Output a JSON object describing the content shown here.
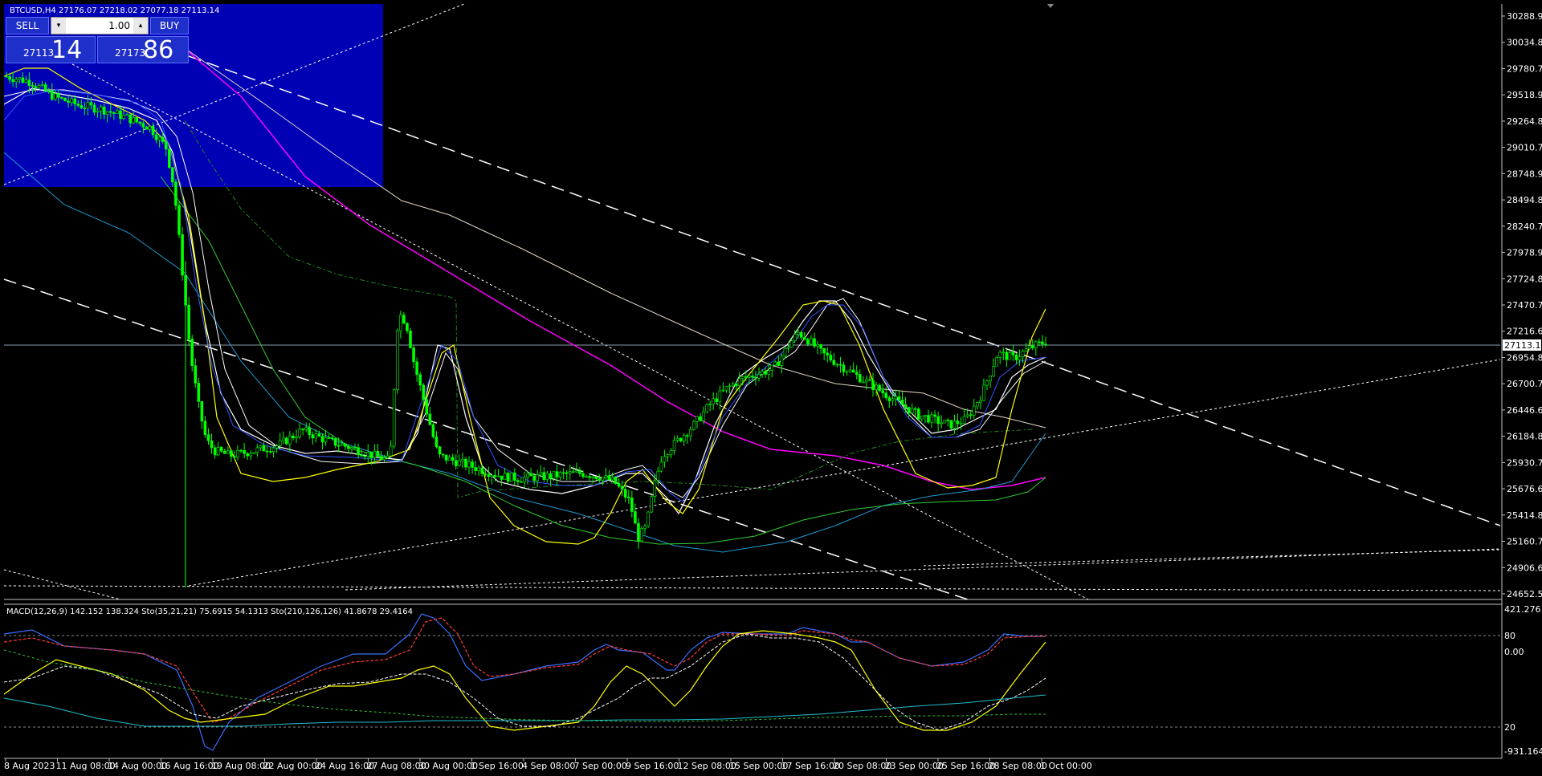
{
  "symbol_header": {
    "symbol": "BTCUSD,H4",
    "ohlc": "27176.07 27218.02 27077.18 27113.14"
  },
  "trade_panel": {
    "sell_label": "SELL",
    "buy_label": "BUY",
    "lot": "1.00",
    "sell_small": "27113",
    "sell_big": "14",
    "buy_small": "27173",
    "buy_big": "86"
  },
  "current_price": "27113.14",
  "colors": {
    "candles": "#00ff00",
    "panel": "#0000b4",
    "ma_white": "#ffffff",
    "ma_yellow": "#ffff00",
    "ma_magenta": "#ff00ff",
    "ma_cyan": "#1e9bd2",
    "ma_green": "#32cd32",
    "ma_beige": "#e8d8c8"
  },
  "chart_data": [
    {
      "type": "candlestick",
      "title": "BTCUSD,H4",
      "y_ticks": [
        "30288.90",
        "30034.80",
        "29780.70",
        "29518.90",
        "29264.80",
        "29010.70",
        "28748.90",
        "28494.80",
        "28240.70",
        "27978.90",
        "27724.80",
        "27470.70",
        "27216.60",
        "26954.80",
        "26700.70",
        "26446.60",
        "26184.80",
        "25930.70",
        "25676.60",
        "25414.80",
        "25160.70",
        "24906.60",
        "24652.50"
      ],
      "ylim": [
        24652.5,
        30288.9
      ],
      "x_ticks": [
        "8 Aug 2023",
        "11 Aug 08:00",
        "14 Aug 00:00",
        "16 Aug 16:00",
        "19 Aug 08:00",
        "22 Aug 00:00",
        "24 Aug 16:00",
        "27 Aug 08:00",
        "30 Aug 00:00",
        "1 Sep 16:00",
        "4 Sep 08:00",
        "7 Sep 00:00",
        "9 Sep 16:00",
        "12 Sep 08:00",
        "15 Sep 00:00",
        "17 Sep 16:00",
        "20 Sep 08:00",
        "23 Sep 00:00",
        "25 Sep 16:00",
        "28 Sep 08:00",
        "1 Oct 00:00"
      ],
      "close_path": [
        [
          0,
          29700
        ],
        [
          3,
          29650
        ],
        [
          6,
          29500
        ],
        [
          9,
          29420
        ],
        [
          12,
          29380
        ],
        [
          15,
          29300
        ],
        [
          18,
          29200
        ],
        [
          20,
          29000
        ],
        [
          21,
          28600
        ],
        [
          22,
          27800
        ],
        [
          23,
          27000
        ],
        [
          24,
          26500
        ],
        [
          25,
          26150
        ],
        [
          26,
          26050
        ],
        [
          28,
          26000
        ],
        [
          31,
          26050
        ],
        [
          34,
          26100
        ],
        [
          37,
          26250
        ],
        [
          40,
          26150
        ],
        [
          43,
          26080
        ],
        [
          46,
          26000
        ],
        [
          48,
          25950
        ],
        [
          49,
          27400
        ],
        [
          50,
          27300
        ],
        [
          51,
          26900
        ],
        [
          52,
          26600
        ],
        [
          54,
          26000
        ],
        [
          56,
          25950
        ],
        [
          58,
          25900
        ],
        [
          60,
          25850
        ],
        [
          62,
          25800
        ],
        [
          64,
          25780
        ],
        [
          66,
          25790
        ],
        [
          68,
          25800
        ],
        [
          70,
          25820
        ],
        [
          72,
          25830
        ],
        [
          74,
          25800
        ],
        [
          76,
          25750
        ],
        [
          78,
          25550
        ],
        [
          79,
          25200
        ],
        [
          80,
          25300
        ],
        [
          81,
          25700
        ],
        [
          82,
          26000
        ],
        [
          84,
          26150
        ],
        [
          86,
          26300
        ],
        [
          88,
          26500
        ],
        [
          90,
          26650
        ],
        [
          92,
          26750
        ],
        [
          94,
          26800
        ],
        [
          96,
          26850
        ],
        [
          98,
          27100
        ],
        [
          99,
          27200
        ],
        [
          100,
          27150
        ],
        [
          102,
          27000
        ],
        [
          104,
          26900
        ],
        [
          106,
          26800
        ],
        [
          108,
          26700
        ],
        [
          110,
          26600
        ],
        [
          112,
          26500
        ],
        [
          114,
          26400
        ],
        [
          116,
          26350
        ],
        [
          118,
          26300
        ],
        [
          120,
          26350
        ],
        [
          122,
          26600
        ],
        [
          124,
          27000
        ],
        [
          126,
          26950
        ],
        [
          128,
          27050
        ],
        [
          130,
          27113
        ]
      ]
    },
    {
      "type": "line",
      "title": "MACD(12,26,9) 142.152 138.324 Sto(35,21,21) 75.6915 54.1313 Sto(210,126,126) 41.8678 29.4164",
      "y_ticks_top": "421.276",
      "y_ticks": [
        "80",
        "0.00",
        "20"
      ],
      "y_ticks_bottom": "-931.164",
      "series": [
        {
          "values_macd": [
            350,
            300,
            250,
            200,
            180,
            160,
            140,
            0,
            -400,
            -700,
            -650,
            -400,
            -200,
            -50,
            100,
            150,
            180,
            200,
            220,
            400,
            600,
            450,
            150,
            100,
            120,
            130,
            140,
            160,
            120,
            80,
            100,
            200,
            300,
            400,
            350,
            330,
            300,
            250,
            200,
            150,
            120,
            140,
            180,
            220,
            240
          ]
        }
      ]
    }
  ]
}
